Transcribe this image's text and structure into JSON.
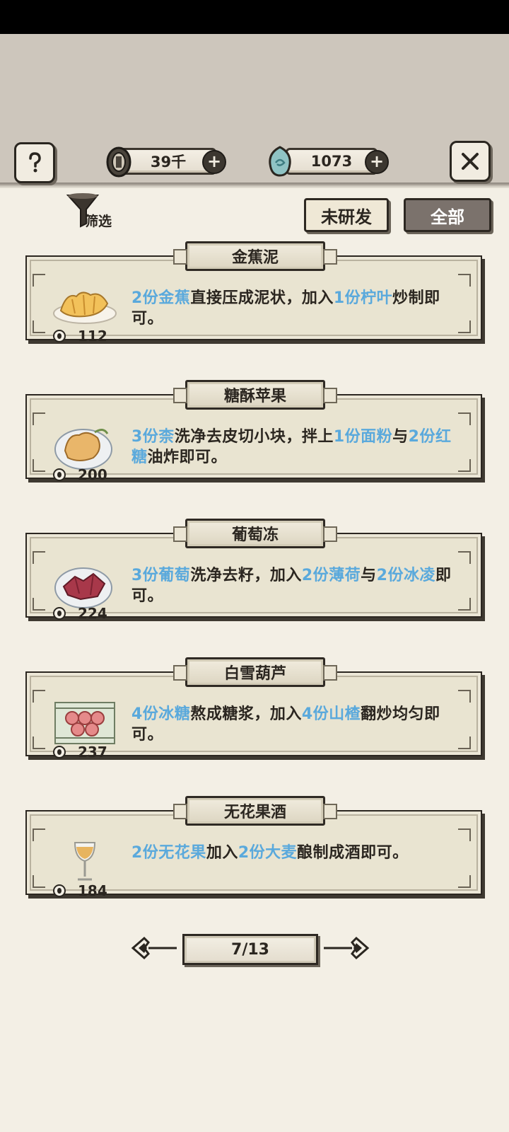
{
  "topbar": {
    "coins": "39千",
    "gems": "1073"
  },
  "filter": {
    "label": "筛选"
  },
  "tabs": {
    "undeveloped": "未研发",
    "all": "全部",
    "active": "全部"
  },
  "recipes": [
    {
      "name": "金蕉泥",
      "price": "112",
      "dish_icon": "banana-mash-icon",
      "desc": [
        {
          "t": "2份金蕉",
          "h": true
        },
        {
          "t": "直接压成泥状，加入",
          "h": false
        },
        {
          "t": "1份柠叶",
          "h": true
        },
        {
          "t": "炒制即可。",
          "h": false
        }
      ]
    },
    {
      "name": "糖酥苹果",
      "price": "200",
      "dish_icon": "fried-apple-icon",
      "desc": [
        {
          "t": "3份柰",
          "h": true
        },
        {
          "t": "洗净去皮切小块，拌上",
          "h": false
        },
        {
          "t": "1份面粉",
          "h": true
        },
        {
          "t": "与",
          "h": false
        },
        {
          "t": "2份红糖",
          "h": true
        },
        {
          "t": "油炸即可。",
          "h": false
        }
      ]
    },
    {
      "name": "葡萄冻",
      "price": "224",
      "dish_icon": "grape-jelly-icon",
      "desc": [
        {
          "t": "3份葡萄",
          "h": true
        },
        {
          "t": "洗净去籽，加入",
          "h": false
        },
        {
          "t": "2份薄荷",
          "h": true
        },
        {
          "t": "与",
          "h": false
        },
        {
          "t": "2份冰凌",
          "h": true
        },
        {
          "t": "即可。",
          "h": false
        }
      ]
    },
    {
      "name": "白雪葫芦",
      "price": "237",
      "dish_icon": "candied-haw-icon",
      "desc": [
        {
          "t": "4份冰糖",
          "h": true
        },
        {
          "t": "熬成糖浆，加入",
          "h": false
        },
        {
          "t": "4份山楂",
          "h": true
        },
        {
          "t": "翻炒均匀即可。",
          "h": false
        }
      ]
    },
    {
      "name": "无花果酒",
      "price": "184",
      "dish_icon": "fig-wine-icon",
      "desc": [
        {
          "t": "2份无花果",
          "h": true
        },
        {
          "t": "加入",
          "h": false
        },
        {
          "t": "2份大麦",
          "h": true
        },
        {
          "t": "酿制成酒即可。",
          "h": false
        }
      ]
    }
  ],
  "pagination": {
    "label": "7/13"
  },
  "colors": {
    "highlight": "#5aa9dc",
    "background": "#f3efe5",
    "card": "#e9e4d1"
  }
}
